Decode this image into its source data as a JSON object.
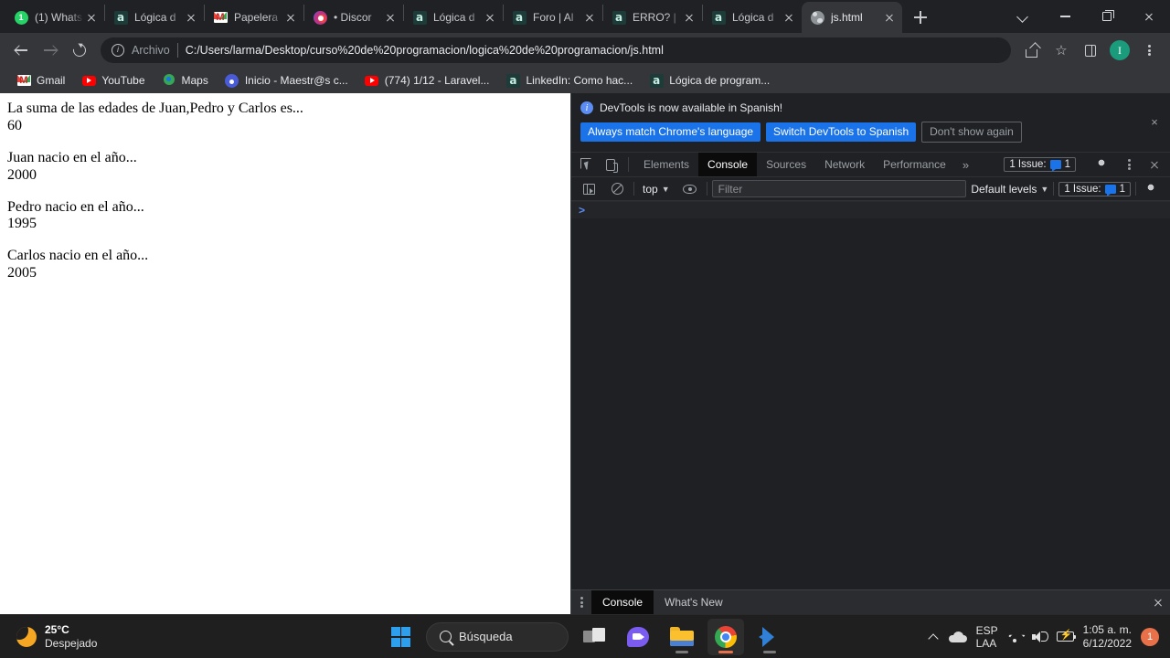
{
  "browser": {
    "tabs": [
      {
        "title": "(1) Whats",
        "favicon": "whatsapp-icon"
      },
      {
        "title": "Lógica d",
        "favicon": "alura-icon"
      },
      {
        "title": "Papelera",
        "favicon": "gmail-icon"
      },
      {
        "title": "• Discor",
        "favicon": "discord-icon"
      },
      {
        "title": "Lógica d",
        "favicon": "alura-icon"
      },
      {
        "title": "Foro | Al",
        "favicon": "alura-icon"
      },
      {
        "title": "ERRO? | ",
        "favicon": "alura-icon"
      },
      {
        "title": "Lógica d",
        "favicon": "alura-icon"
      },
      {
        "title": "js.html",
        "favicon": "globe-icon",
        "active": true
      }
    ],
    "new_tab_label": "+",
    "window_controls": {
      "tab_search": "tab-search-chevron",
      "minimize": "minimize",
      "maximize": "maximize",
      "close": "close"
    },
    "omnibox": {
      "scheme_label": "Archivo",
      "url": "C:/Users/larma/Desktop/curso%20de%20programacion/logica%20de%20programacion/js.html",
      "avatar_letter": "I"
    },
    "bookmarks": [
      {
        "label": "Gmail",
        "icon": "gmail-icon"
      },
      {
        "label": "YouTube",
        "icon": "youtube-icon"
      },
      {
        "label": "Maps",
        "icon": "maps-icon"
      },
      {
        "label": "Inicio - Maestr@s c...",
        "icon": "site-icon"
      },
      {
        "label": "(774) 1/12 - Laravel...",
        "icon": "youtube-icon"
      },
      {
        "label": "LinkedIn: Como hac...",
        "icon": "alura-icon"
      },
      {
        "label": "Lógica de program...",
        "icon": "alura-icon"
      }
    ]
  },
  "page": {
    "lines": [
      "La suma de las edades de Juan,Pedro y Carlos es...",
      "60",
      "Juan nacio en el año...",
      "2000",
      "Pedro nacio en el año...",
      "1995",
      "Carlos nacio en el año...",
      "2005"
    ]
  },
  "devtools": {
    "banner": {
      "message": "DevTools is now available in Spanish!",
      "primary_button": "Always match Chrome's language",
      "secondary_button": "Switch DevTools to Spanish",
      "dismiss_button": "Don't show again",
      "close": "×"
    },
    "tabs": [
      {
        "label": "Elements"
      },
      {
        "label": "Console",
        "active": true
      },
      {
        "label": "Sources"
      },
      {
        "label": "Network"
      },
      {
        "label": "Performance"
      }
    ],
    "more_tabs": "»",
    "issues": {
      "label": "1 Issue:",
      "count": "1"
    },
    "filterbar": {
      "context": "top",
      "filter_placeholder": "Filter",
      "filter_value": "",
      "levels": "Default levels"
    },
    "console_prompt": ">",
    "drawer": {
      "tabs": [
        {
          "label": "Console",
          "active": true
        },
        {
          "label": "What's New"
        }
      ]
    }
  },
  "taskbar": {
    "weather": {
      "temperature": "25°C",
      "condition": "Despejado"
    },
    "search_placeholder": "Búsqueda",
    "apps": [
      {
        "name": "start"
      },
      {
        "name": "task-view"
      },
      {
        "name": "chat"
      },
      {
        "name": "file-explorer"
      },
      {
        "name": "chrome"
      },
      {
        "name": "vscode"
      }
    ],
    "tray": {
      "language_line1": "ESP",
      "language_line2": "LAA",
      "time": "1:05 a. m.",
      "date": "6/12/2022",
      "notification_count": "1"
    }
  }
}
